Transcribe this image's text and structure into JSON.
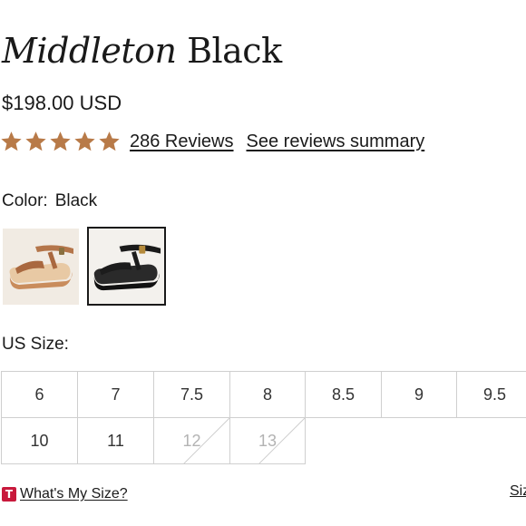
{
  "product": {
    "name_italic": "Middleton",
    "name_color": "Black",
    "price": "$198.00 USD"
  },
  "reviews": {
    "rating": 5,
    "star_color": "#b87a48",
    "count_label": "286 Reviews",
    "summary_label": "See reviews summary"
  },
  "color": {
    "label": "Color:",
    "selected": "Black",
    "options": [
      {
        "name": "tan-sandal",
        "selected": false
      },
      {
        "name": "black-sandal",
        "selected": true
      }
    ]
  },
  "size": {
    "label": "US Size:",
    "sizes": [
      {
        "label": "6",
        "available": true
      },
      {
        "label": "7",
        "available": true
      },
      {
        "label": "7.5",
        "available": true
      },
      {
        "label": "8",
        "available": true
      },
      {
        "label": "8.5",
        "available": true
      },
      {
        "label": "9",
        "available": true
      },
      {
        "label": "9.5",
        "available": true
      },
      {
        "label": "10",
        "available": true
      },
      {
        "label": "11",
        "available": true
      },
      {
        "label": "12",
        "available": false
      },
      {
        "label": "13",
        "available": false
      }
    ]
  },
  "fit": {
    "badge": "T",
    "link_label": "What's My Size?",
    "size_chart_label": "Siz"
  }
}
